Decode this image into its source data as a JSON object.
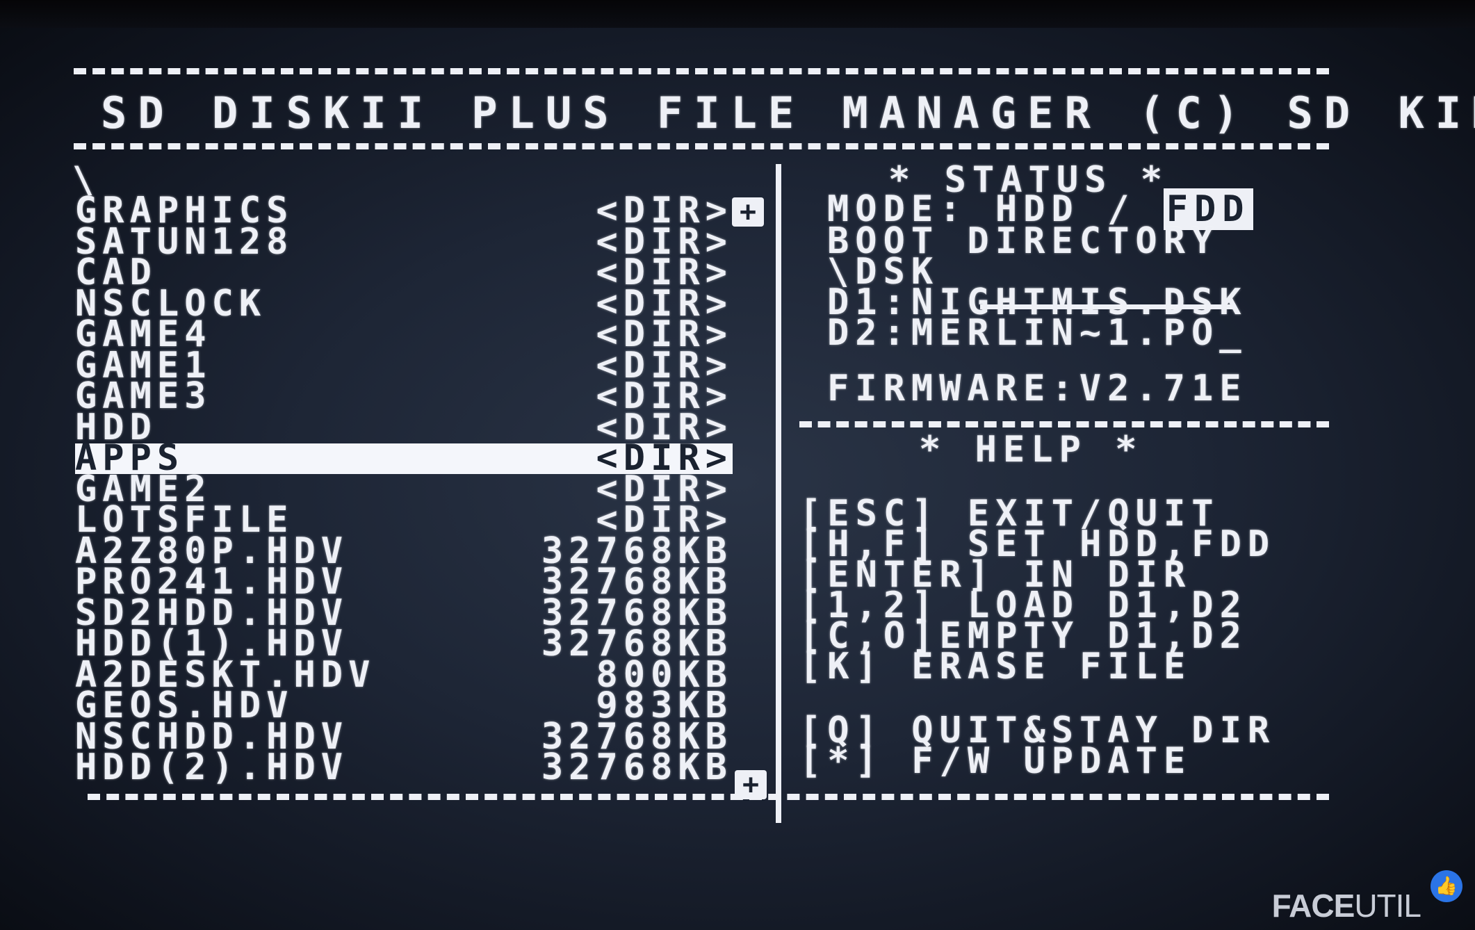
{
  "title": "SD DISKII PLUS FILE MANAGER (C) SD KIM",
  "current_path": "\\",
  "files": [
    {
      "name": "GRAPHICS",
      "size": "<DIR>"
    },
    {
      "name": "SATUN128",
      "size": "<DIR>"
    },
    {
      "name": "CAD",
      "size": "<DIR>"
    },
    {
      "name": "NSCLOCK",
      "size": "<DIR>"
    },
    {
      "name": "GAME4",
      "size": "<DIR>"
    },
    {
      "name": "GAME1",
      "size": "<DIR>"
    },
    {
      "name": "GAME3",
      "size": "<DIR>"
    },
    {
      "name": "HDD",
      "size": "<DIR>"
    },
    {
      "name": "APPS",
      "size": "<DIR>",
      "selected": true
    },
    {
      "name": "GAME2",
      "size": "<DIR>"
    },
    {
      "name": "LOTSFILE",
      "size": "<DIR>"
    },
    {
      "name": "A2Z80P.HDV",
      "size": "32768KB"
    },
    {
      "name": "PRO241.HDV",
      "size": "32768KB"
    },
    {
      "name": "SD2HDD.HDV",
      "size": "32768KB"
    },
    {
      "name": "HDD(1).HDV",
      "size": "32768KB"
    },
    {
      "name": "A2DESKT.HDV",
      "size": "800KB"
    },
    {
      "name": "GEOS.HDV",
      "size": "983KB"
    },
    {
      "name": "NSCHDD.HDV",
      "size": "32768KB"
    },
    {
      "name": "HDD(2).HDV",
      "size": "32768KB"
    }
  ],
  "scroll_up_mark": "+",
  "scroll_down_mark": "+",
  "status": {
    "heading": "* STATUS *",
    "mode_label": "MODE: HDD / ",
    "mode_active": "FDD",
    "boot_dir_label": "BOOT DIRECTORY",
    "boot_dir_value": "\\DSK",
    "d1": "D1:NIGHTMIS.DSK",
    "d2": "D2:MERLIN~1.PO_",
    "firmware": "FIRMWARE:V2.71E"
  },
  "help": {
    "heading": "* HELP *",
    "lines": [
      "[ESC] EXIT/QUIT",
      "[H,F] SET HDD,FDD",
      "[ENTER] IN DIR",
      "[1,2] LOAD D1,D2",
      "[C,O]EMPTY D1,D2",
      "[K] ERASE FILE",
      "[Q] QUIT&STAY DIR",
      "[*] F/W UPDATE"
    ]
  },
  "watermark": {
    "bold": "FACE",
    "regular": "UTIL"
  }
}
